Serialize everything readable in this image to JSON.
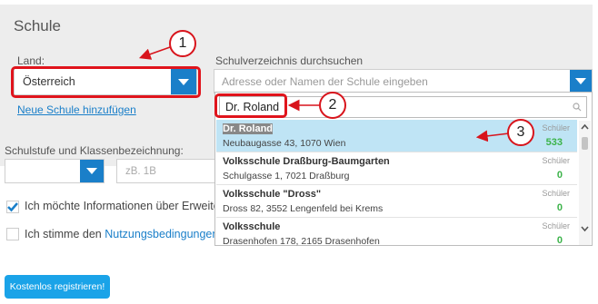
{
  "form": {
    "title": "Schule",
    "land_label": "Land:",
    "land_value": "Österreich",
    "add_school_link": "Neue Schule hinzufügen",
    "search_label": "Schulverzeichnis durchsuchen",
    "search_placeholder": "Adresse oder Namen der Schule eingeben",
    "grade_label": "Schulstufe und Klassenbezeichnung:",
    "class_placeholder": "zB. 1B",
    "info_consent": "Ich möchte Informationen über Erweiteru",
    "terms_prefix": "Ich stimme den ",
    "terms_link": "Nutzungsbedingungen v",
    "register_button": "Kostenlos registrieren!"
  },
  "dropdown": {
    "query": "Dr. Roland",
    "results": [
      {
        "name_highlight": "Dr. Roland",
        "address": "Neubaugasse 43, 1070 Wien",
        "students_label": "Schüler",
        "students": "533"
      },
      {
        "name": "Volksschule Draßburg-Baumgarten",
        "address": "Schulgasse 1, 7021 Draßburg",
        "students_label": "Schüler",
        "students": "0"
      },
      {
        "name": "Volksschule \"Dross\"",
        "address": "Dross 82, 3552 Lengenfeld bei Krems",
        "students_label": "Schüler",
        "students": "0"
      },
      {
        "name": "Volksschule",
        "address": "Drasenhofen 178, 2165 Drasenhofen",
        "students_label": "Schüler",
        "students": "0"
      }
    ]
  },
  "annotations": {
    "one": "1",
    "two": "2",
    "three": "3"
  },
  "colors": {
    "accent": "#1a7fc9",
    "annotation_red": "#e0141c",
    "selected_row": "#bfe4f5",
    "count_green": "#3cb34a"
  }
}
